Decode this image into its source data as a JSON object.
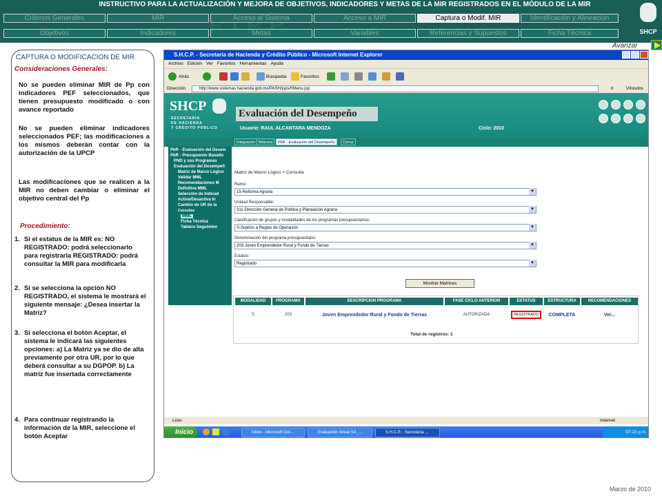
{
  "header": {
    "title": "INSTRUCTIVO PARA  LA ACTUALIZACIÓN Y MEJORA DE OBJETIVOS, INDICADORES Y METAS DE LA MIR REGISTRADOS EN EL MÓDULO DE LA MIR",
    "watermark": "PIPP",
    "logo_text": "SHCP",
    "nav_row1": [
      "Criterios Generales",
      "MIR",
      "Acceso al Sistema",
      "Acceso a MIR",
      "Captura o Modif. MIR",
      "Identificación y Alineación"
    ],
    "nav_row2": [
      "Objetivos",
      "Indicadores",
      "Metas",
      "Variables",
      "Referencias y Supuestos",
      "Ficha Técnica"
    ],
    "active": "Captura o Modif. MIR",
    "avanzar": "Avanzar"
  },
  "left": {
    "title": "CAPTURA O MODIFICACION DE MIR",
    "considerations": "Consideraciones Generales:",
    "paras": [
      "No se pueden eliminar MIR de Pp con indicadores PEF seleccionados, que tienen presupuesto modificado o con avance reportado",
      "No se pueden eliminar indicadores seleccionados PEF; las modificaciones a los mismos deberán contar con la autorización de la UPCP",
      "Las modificaciones que se realicen a la MIR no deben cambiar o eliminar el objetivo central del Pp"
    ],
    "procedure": "Procedimiento:",
    "steps": [
      {
        "num": "1.",
        "text": "Si el estatus de la MIR es: NO REGISTRADO: podrá seleccionarlo para registrarla REGISTRADO: podrá consultar la MIR para modificarla"
      },
      {
        "num": "2.",
        "text": "Si se selecciona la opción NO REGISTRADO, el sistema le mostrará el siguiente mensaje: ¿Desea insertar la Matriz?"
      },
      {
        "num": "3.",
        "text": "Si selecciona el botón Aceptar, el sistema le indicará las siguientes opciones: a) La Matriz ya se dio de alta previamente por otra UR, por lo que deberá consultar a su DGPOP. b) La matriz fue insertada correctamente"
      },
      {
        "num": "4.",
        "text": "Para continuar registrando la información de la MIR, seleccione el botón Aceptar"
      }
    ]
  },
  "date": "Marzo de 2010",
  "browser": {
    "title": "S.H.C.P. - Secretaría de Hacienda y Crédito Público - Microsoft Internet Explorer",
    "menu": [
      "Archivo",
      "Edición",
      "Ver",
      "Favoritos",
      "Herramientas",
      "Ayuda"
    ],
    "toolbar": {
      "back": "Atrás",
      "search": "Búsqueda",
      "favorites": "Favoritos"
    },
    "address_label": "Dirección",
    "address": "http://www.sistemas.hacienda.gob.mx/PASH/jsps/frMenu.jsp",
    "go": "Ir",
    "links": "Vínculos",
    "status": "Listo",
    "zone": "Internet"
  },
  "app": {
    "logo": "SHCP",
    "secretaria": "SECRETARÍA\nDE HACIENDA\nY CRÉDITO PÚBLICO",
    "title": "Evaluación del Desempeño",
    "user": "Usuario: RAUL ALCANTARA MENDOZA",
    "ciclo": "Ciclo: 2010",
    "tabs": [
      "Integración",
      "Bitácora",
      "PbR - Evaluación del Desempeño",
      "Cerrar"
    ],
    "sidebar": [
      "PbR - Evaluación del Desem",
      "PbR - Presupuesto Basado",
      "PND y sus Programas",
      "Evaluación del Desempeñ",
      "Matriz de Marco Lógico",
      "Validar MML",
      "Recomendaciones M",
      "Definitiva MML",
      "Selección de Indicad",
      "Activa/Desactiva In",
      "Cambio de UR de la",
      "Consultas",
      "MML",
      "Ficha Técnica",
      "Tablero Seguimien"
    ],
    "breadcrumb": "Matriz de Marco Lógico > Consulta",
    "fields": [
      {
        "label": "Ramo:",
        "value": "15-Reforma Agraria"
      },
      {
        "label": "Unidad Responsable:",
        "value": "311-Dirección General de Política y Planeación Agraria"
      },
      {
        "label": "Clasificación de grupos y modalidades de los programas presupuestarios:",
        "value": "S-Sujetos a Reglas de Operación"
      },
      {
        "label": "Denominación del programa presupuestario:",
        "value": "203-Joven Emprendedor Rural y Fondo de Tierras"
      },
      {
        "label": "Estatus:",
        "value": "Registrado"
      }
    ],
    "button": "Mostrar Matrices",
    "columns": [
      "MODALIDAD",
      "PROGRAMA",
      "DESCRIPCION PROGRAMA",
      "FASE CICLO ANTERIOR",
      "ESTATUS",
      "ESTRUCTURA",
      "RECOMENDACIONES"
    ],
    "row": [
      "S",
      "203",
      "Joven Emprendedor Rural y Fondo de Tierras",
      "AUTORIZADA",
      "REGISTRADO",
      "COMPLETA",
      "Ver..."
    ],
    "total": "Total de registros: 1"
  },
  "taskbar": {
    "start": "Inicio",
    "tasks": [
      "Inbox - Microsoft Out...",
      "Evaluación Anual SA_...",
      "S.H.C.P. - Secretaría ..."
    ],
    "clock": "07:23 p.m."
  }
}
